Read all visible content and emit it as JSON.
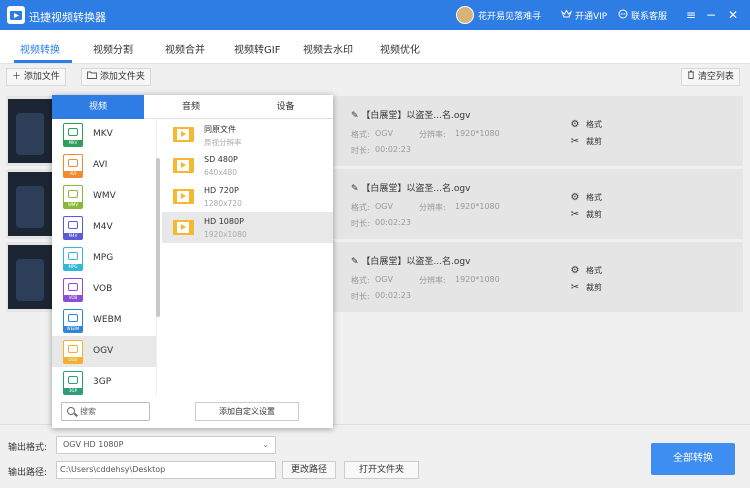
{
  "app": {
    "title": "迅捷视频转换器",
    "user_name": "花开易见落难寻",
    "vip_label": "开通VIP",
    "support_label": "联系客服"
  },
  "tabs": [
    {
      "label": "视频转换"
    },
    {
      "label": "视频分割"
    },
    {
      "label": "视频合并"
    },
    {
      "label": "视频转GIF"
    },
    {
      "label": "视频去水印"
    },
    {
      "label": "视频优化"
    }
  ],
  "toolbar": {
    "add_file": "添加文件",
    "add_folder": "添加文件夹",
    "clear_list": "清空列表"
  },
  "files": [
    {
      "name": "【白展堂】以盗圣...名.ogv",
      "format_label": "格式:",
      "format": "OGV",
      "res_label": "分辨率:",
      "resolution": "1920*1080",
      "dur_label": "时长:",
      "duration": "00:02:23",
      "action_format": "格式",
      "action_cut": "裁剪"
    },
    {
      "name": "【白展堂】以盗圣...名.ogv",
      "format_label": "格式:",
      "format": "OGV",
      "res_label": "分辨率:",
      "resolution": "1920*1080",
      "dur_label": "时长:",
      "duration": "00:02:23",
      "action_format": "格式",
      "action_cut": "裁剪"
    },
    {
      "name": "【白展堂】以盗圣...名.ogv",
      "format_label": "格式:",
      "format": "OGV",
      "res_label": "分辨率:",
      "resolution": "1920*1080",
      "dur_label": "时长:",
      "duration": "00:02:23",
      "action_format": "格式",
      "action_cut": "裁剪"
    }
  ],
  "popup": {
    "tabs": [
      {
        "label": "视频"
      },
      {
        "label": "音频"
      },
      {
        "label": "设备"
      }
    ],
    "formats": [
      {
        "label": "MKV",
        "badge": "MKV",
        "color": "#2e9e5b"
      },
      {
        "label": "AVI",
        "badge": "AVI",
        "color": "#f28a2e"
      },
      {
        "label": "WMV",
        "badge": "WMV",
        "color": "#8bb83a"
      },
      {
        "label": "M4V",
        "badge": "M4V",
        "color": "#5b5bd6"
      },
      {
        "label": "MPG",
        "badge": "MPG",
        "color": "#38b6d9"
      },
      {
        "label": "VOB",
        "badge": "VOB",
        "color": "#8a4fd6"
      },
      {
        "label": "WEBM",
        "badge": "WEBM",
        "color": "#2f86d9"
      },
      {
        "label": "OGV",
        "badge": "OGV",
        "color": "#f2b12e"
      },
      {
        "label": "3GP",
        "badge": "3GP",
        "color": "#2e9e7a"
      }
    ],
    "qualities": [
      {
        "title": "同原文件",
        "sub": "原视分辨率"
      },
      {
        "title": "SD 480P",
        "sub": "640x480"
      },
      {
        "title": "HD 720P",
        "sub": "1280x720"
      },
      {
        "title": "HD 1080P",
        "sub": "1920x1080"
      }
    ],
    "search_placeholder": "搜索",
    "custom_button": "添加自定义设置"
  },
  "bottom": {
    "format_label": "输出格式:",
    "format_value": "OGV   HD 1080P",
    "path_label": "输出路径:",
    "path_value": "C:\\Users\\cddehsy\\Desktop",
    "change_path": "更改路径",
    "open_folder": "打开文件夹",
    "convert_all": "全部转换"
  }
}
